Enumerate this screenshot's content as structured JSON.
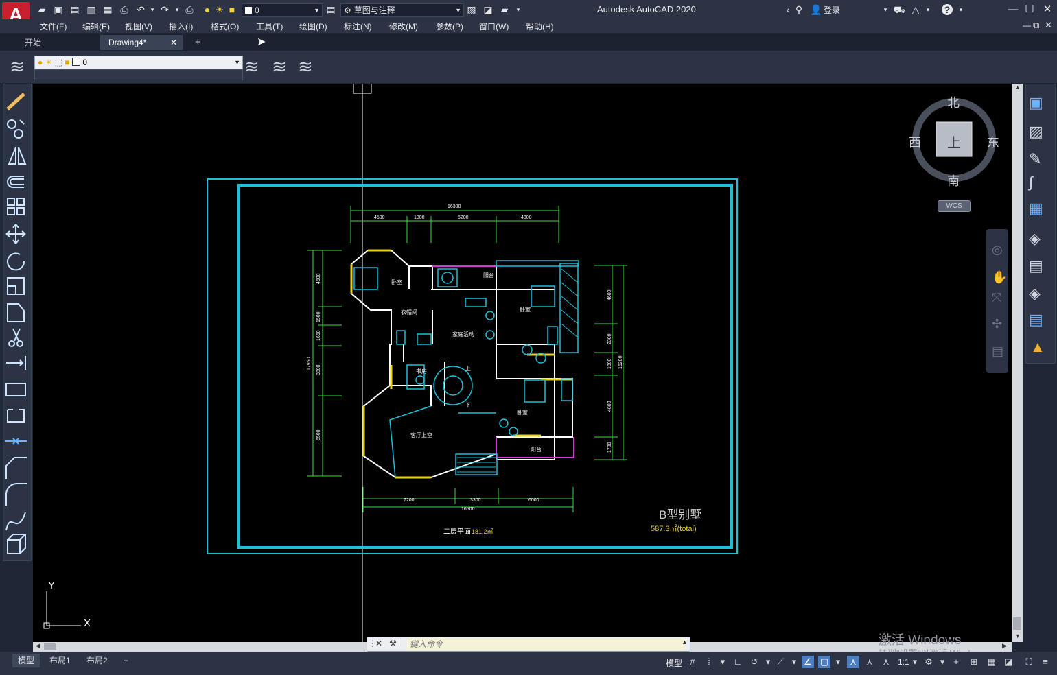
{
  "titlebar": {
    "app_title": "Autodesk AutoCAD 2020",
    "layer_current": "0",
    "workspace": "草图与注释",
    "sign_in": "登录"
  },
  "menu": {
    "items": [
      "文件(F)",
      "编辑(E)",
      "视图(V)",
      "插入(I)",
      "格式(O)",
      "工具(T)",
      "绘图(D)",
      "标注(N)",
      "修改(M)",
      "参数(P)",
      "窗口(W)",
      "帮助(H)"
    ]
  },
  "tabs": {
    "start": "开始",
    "drawing": "Drawing4*",
    "close": "✕",
    "add": "+"
  },
  "layers": {
    "current": "0"
  },
  "viewcube": {
    "north": "北",
    "south": "南",
    "east": "东",
    "west": "西",
    "top_face": "上",
    "wcs": "WCS"
  },
  "drawing": {
    "title": "B型别墅",
    "total_area": "587.3㎡(total)",
    "floor_caption": "二层平面",
    "floor_area": "181.2㎡",
    "dims_top": [
      "16300",
      "4500",
      "1800",
      "5200",
      "4800"
    ],
    "dims_bottom": [
      "7200",
      "3300",
      "6000",
      "16500"
    ],
    "dims_left": [
      "4500",
      "1500",
      "1650",
      "3800",
      "6500",
      "17950"
    ],
    "dims_right": [
      "4600",
      "2300",
      "1800",
      "4800",
      "1700",
      "15200"
    ],
    "rooms": [
      "卧室",
      "阳台",
      "衣帽间",
      "家庭活动",
      "卧室",
      "书房",
      "上",
      "下",
      "卧室",
      "客厅上空",
      "阳台"
    ],
    "ucs_x": "X",
    "ucs_y": "Y"
  },
  "command": {
    "placeholder": "键入命令"
  },
  "status": {
    "model_tab": "模型",
    "layout1": "布局1",
    "layout2": "布局2",
    "add": "+",
    "model_btn": "模型",
    "scale": "1:1"
  },
  "watermark": {
    "line1": "激活 Windows",
    "line2": "转到\"设置\"以激活 Windows。"
  },
  "colors": {
    "frame": "#19c1d9",
    "dimension": "#35e03a",
    "walls": "#ffffff",
    "windows": "#e6d21e",
    "balcony": "#d43bd4",
    "title_text": "#ffe04a"
  }
}
